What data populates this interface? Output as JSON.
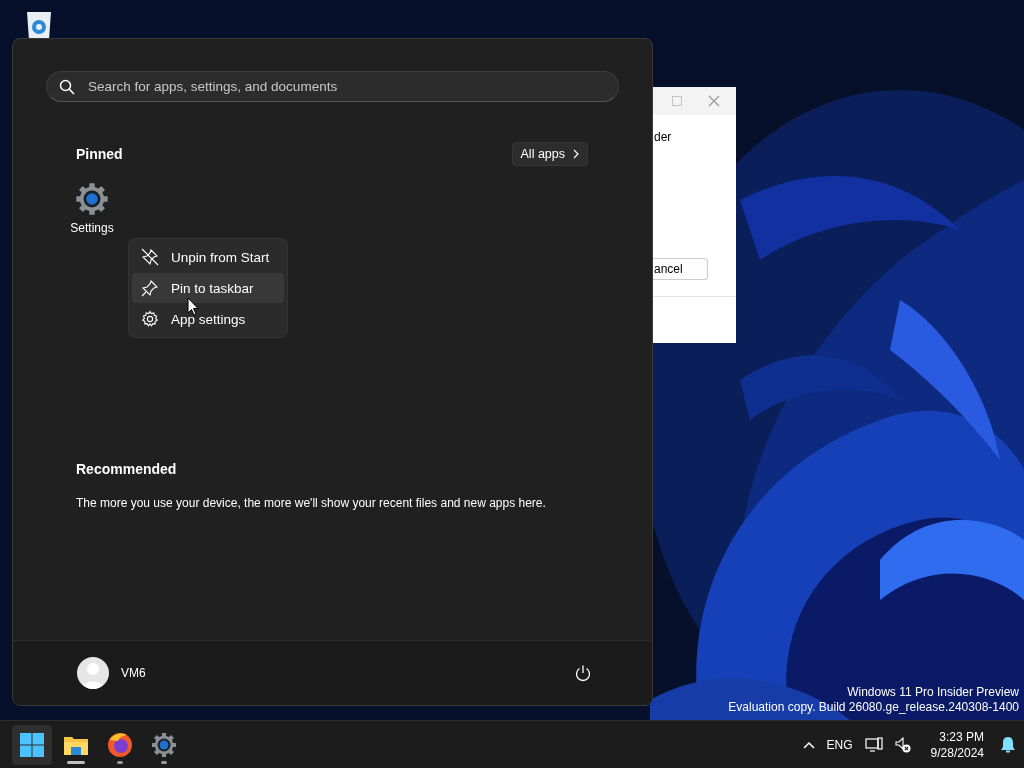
{
  "dialog": {
    "text": "der",
    "button": "ancel"
  },
  "start_menu": {
    "search": {
      "placeholder": "Search for apps, settings, and documents"
    },
    "pinned": {
      "title": "Pinned",
      "all_apps": "All apps",
      "apps": [
        {
          "label": "Settings",
          "kind": "settings"
        }
      ]
    },
    "context_menu": {
      "items": [
        {
          "label": "Unpin from Start",
          "kind": "unpin",
          "selected": false
        },
        {
          "label": "Pin to taskbar",
          "kind": "pin",
          "selected": true
        },
        {
          "label": "App settings",
          "kind": "gear",
          "selected": false
        }
      ]
    },
    "recommended": {
      "title": "Recommended",
      "text": "The more you use your device, the more we'll show your recent files and new apps here."
    },
    "user": {
      "name": "VM6"
    }
  },
  "watermark": [
    "Windows 11 Pro Insider Preview",
    "Evaluation copy. Build 26080.ge_release.240308-1400"
  ],
  "taskbar": {
    "apps": [
      {
        "kind": "start",
        "selected": true
      },
      {
        "kind": "explorer",
        "selected": false,
        "running": true,
        "focused": true
      },
      {
        "kind": "firefox",
        "selected": false,
        "running": true,
        "focused": false
      },
      {
        "kind": "settings",
        "selected": false,
        "running": true,
        "focused": false
      }
    ],
    "language": "ENG",
    "time": "3:23 PM",
    "date": "9/28/2024"
  }
}
